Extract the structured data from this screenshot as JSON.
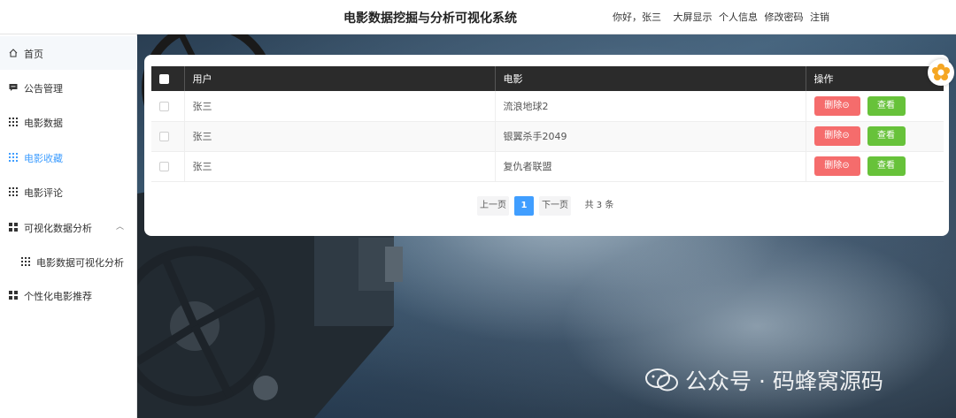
{
  "header": {
    "title": "电影数据挖掘与分析可视化系统",
    "greeting": "你好，张三",
    "links": [
      "大屏显示",
      "个人信息",
      "修改密码",
      "注销"
    ]
  },
  "sidebar": {
    "items": [
      {
        "label": "首页",
        "icon": "home-icon"
      },
      {
        "label": "公告管理",
        "icon": "message-icon"
      },
      {
        "label": "电影数据",
        "icon": "grid-icon"
      },
      {
        "label": "电影收藏",
        "icon": "grid-icon",
        "active": true
      },
      {
        "label": "电影评论",
        "icon": "grid-icon"
      },
      {
        "label": "可视化数据分析",
        "icon": "apps-icon",
        "expanded": true
      },
      {
        "label": "电影数据可视化分析",
        "icon": "grid-icon"
      },
      {
        "label": "个性化电影推荐",
        "icon": "apps-icon"
      }
    ]
  },
  "table": {
    "columns": [
      "用户",
      "电影",
      "操作"
    ],
    "rows": [
      {
        "user": "张三",
        "movie": "流浪地球2"
      },
      {
        "user": "张三",
        "movie": "银翼杀手2049"
      },
      {
        "user": "张三",
        "movie": "复仇者联盟"
      }
    ],
    "delete_label": "删除⊝",
    "view_label": "查看"
  },
  "pagination": {
    "prev": "上一页",
    "current": "1",
    "next": "下一页",
    "total": "共 3 条"
  },
  "watermark": "公众号 · 码蜂窝源码",
  "colors": {
    "primary": "#409eff",
    "danger": "#f56c6c",
    "success": "#67c23a",
    "table_header": "#2b2b2b"
  }
}
